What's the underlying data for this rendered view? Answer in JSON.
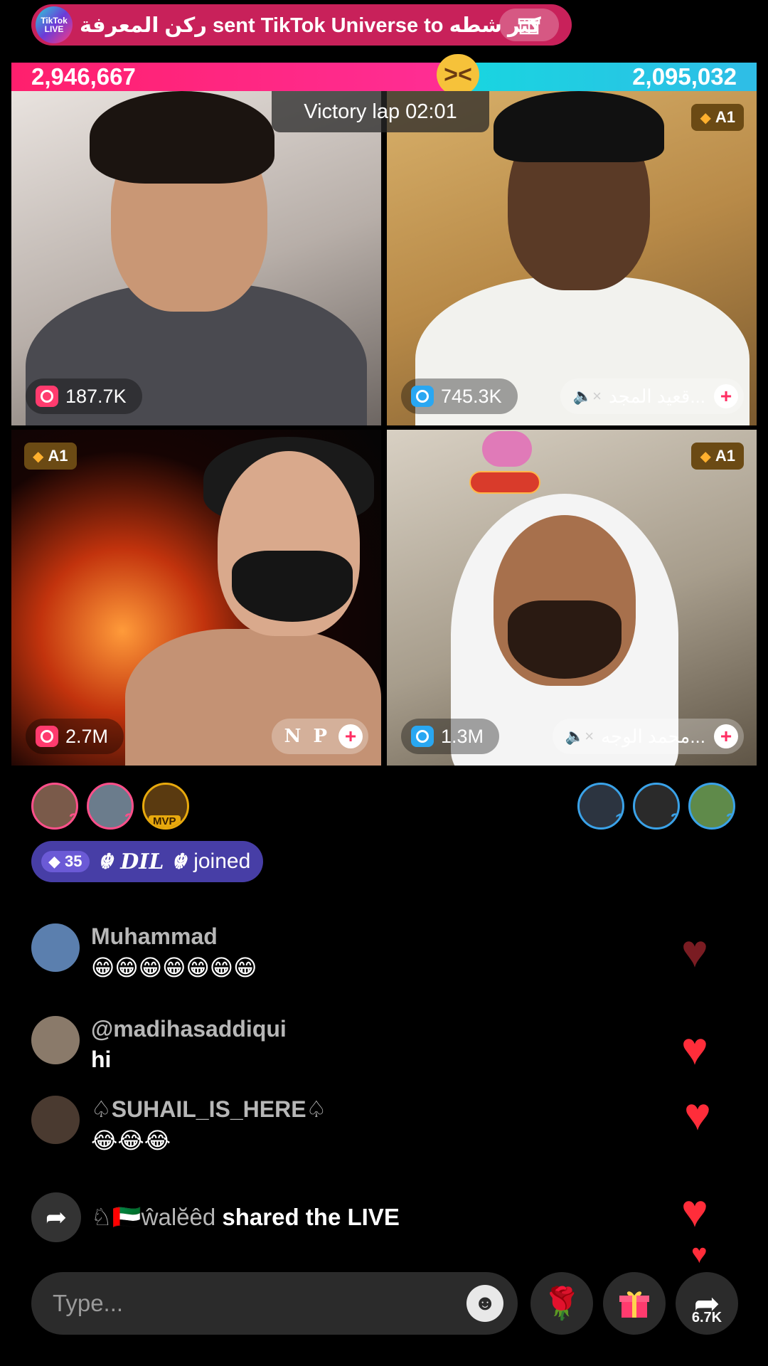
{
  "gift_banner": {
    "logo_text": "TikTok LIVE",
    "text": "ركن المعرفة sent TikTok Universe to كثر شطه",
    "gift_icon": "gift-icon"
  },
  "battle": {
    "score_left": "2,946,667",
    "score_right": "2,095,032",
    "timer_label": "Victory lap  02:01",
    "colors": {
      "left": "#ff1f6d",
      "right": "#18d6e0"
    }
  },
  "tiles": [
    {
      "viewers": "187.7K",
      "cam_color": "pink"
    },
    {
      "viewers": "745.3K",
      "cam_color": "blue",
      "badge": "A1",
      "name": "قعيد المجد..."
    },
    {
      "viewers": "2.7M",
      "cam_color": "pink",
      "badge": "A1",
      "name": "N P"
    },
    {
      "viewers": "1.3M",
      "cam_color": "blue",
      "badge": "A1",
      "name": "محمد الوجه..."
    }
  ],
  "supporters_left": [
    {
      "rank": "3"
    },
    {
      "rank": "2"
    },
    {
      "label": "MVP"
    }
  ],
  "supporters_right": [
    {
      "rank": "1"
    },
    {
      "rank": "2"
    },
    {
      "rank": "3"
    }
  ],
  "joined": {
    "level": "35",
    "user": "☬ DIL ☬",
    "text": "joined"
  },
  "comments": [
    {
      "user": "Muhammad",
      "text": "😁😁😁😁😁😁😁"
    },
    {
      "user": "@madihasaddiqui",
      "text": "hi"
    },
    {
      "user": "♤SUHAIL_IS_HERE♤",
      "text": "😂😂😂"
    }
  ],
  "shared": {
    "user": "♘🇦🇪ŵalĕêd",
    "text": "shared the LIVE"
  },
  "bottom_bar": {
    "input_placeholder": "Type...",
    "share_count": "6.7K"
  }
}
